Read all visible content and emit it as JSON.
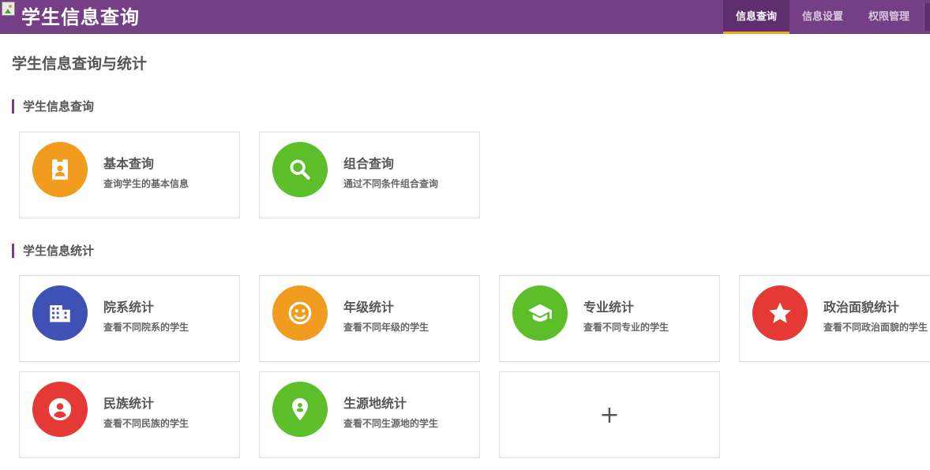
{
  "header": {
    "app_title": "学生信息查询",
    "nav": [
      {
        "label": "信息查询",
        "active": true
      },
      {
        "label": "信息设置",
        "active": false
      },
      {
        "label": "权限管理",
        "active": false
      }
    ]
  },
  "page": {
    "title": "学生信息查询与统计"
  },
  "query_section": {
    "title": "学生信息查询",
    "cards": [
      {
        "title": "基本查询",
        "desc": "查询学生的基本信息",
        "color": "#f29c1f",
        "icon": "badge-icon"
      },
      {
        "title": "组合查询",
        "desc": "通过不同条件组合查询",
        "color": "#5cbf2a",
        "icon": "search-icon"
      }
    ]
  },
  "stats_section": {
    "title": "学生信息统计",
    "cards": [
      {
        "title": "院系统计",
        "desc": "查看不同院系的学生",
        "color": "#3f51b5",
        "icon": "building-icon"
      },
      {
        "title": "年级统计",
        "desc": "查看不同年级的学生",
        "color": "#f29c1f",
        "icon": "smiley-icon"
      },
      {
        "title": "专业统计",
        "desc": "查看不同专业的学生",
        "color": "#5cbf2a",
        "icon": "graduation-cap-icon"
      },
      {
        "title": "政治面貌统计",
        "desc": "查看不同政治面貌的学生",
        "color": "#e53935",
        "icon": "star-icon"
      },
      {
        "title": "民族统计",
        "desc": "查看不同民族的学生",
        "color": "#e53935",
        "icon": "person-circle-icon"
      },
      {
        "title": "生源地统计",
        "desc": "查看不同生源地的学生",
        "color": "#5cbf2a",
        "icon": "location-pin-icon"
      }
    ],
    "add_card": {
      "label": "+"
    }
  }
}
